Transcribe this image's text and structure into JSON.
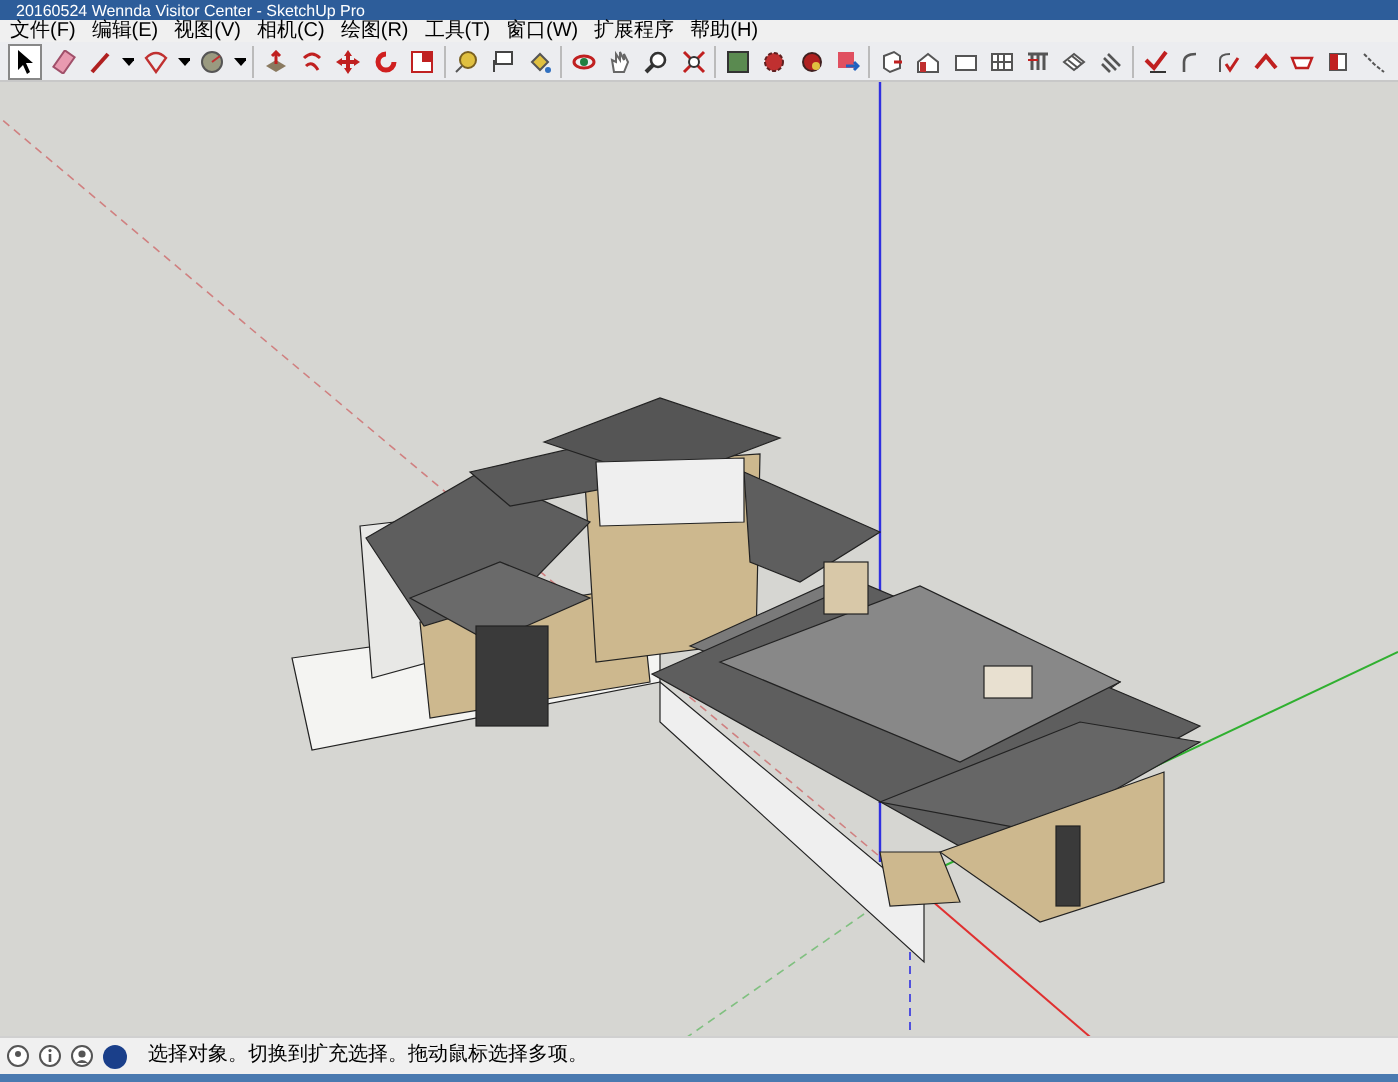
{
  "window": {
    "title": "20160524 Wennda Visitor Center - SketchUp Pro"
  },
  "menu": [
    "文件(F)",
    "编辑(E)",
    "视图(V)",
    "相机(C)",
    "绘图(R)",
    "工具(T)",
    "窗口(W)",
    "扩展程序",
    "帮助(H)"
  ],
  "status_bar": {
    "message": "选择对象。切换到扩充选择。拖动鼠标选择多项。"
  }
}
